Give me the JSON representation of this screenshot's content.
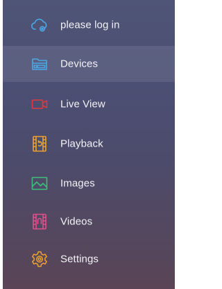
{
  "drawer": {
    "items": [
      {
        "label": "please log in",
        "icon": "cloud-settings-icon",
        "icon_color": "#4aa8e8",
        "selected": false
      },
      {
        "label": "Devices",
        "icon": "devices-icon",
        "icon_color": "#4aa8e8",
        "selected": true
      },
      {
        "label": "Live View",
        "icon": "video-camera-icon",
        "icon_color": "#e0383f",
        "selected": false
      },
      {
        "label": "Playback",
        "icon": "playback-film-icon",
        "icon_color": "#f0a030",
        "selected": false
      },
      {
        "label": "Images",
        "icon": "image-icon",
        "icon_color": "#3bbf7a",
        "selected": false
      },
      {
        "label": "Videos",
        "icon": "video-film-icon",
        "icon_color": "#e0508a",
        "selected": false
      },
      {
        "label": "Settings",
        "icon": "gear-icon",
        "icon_color": "#f0a030",
        "selected": false
      }
    ]
  }
}
